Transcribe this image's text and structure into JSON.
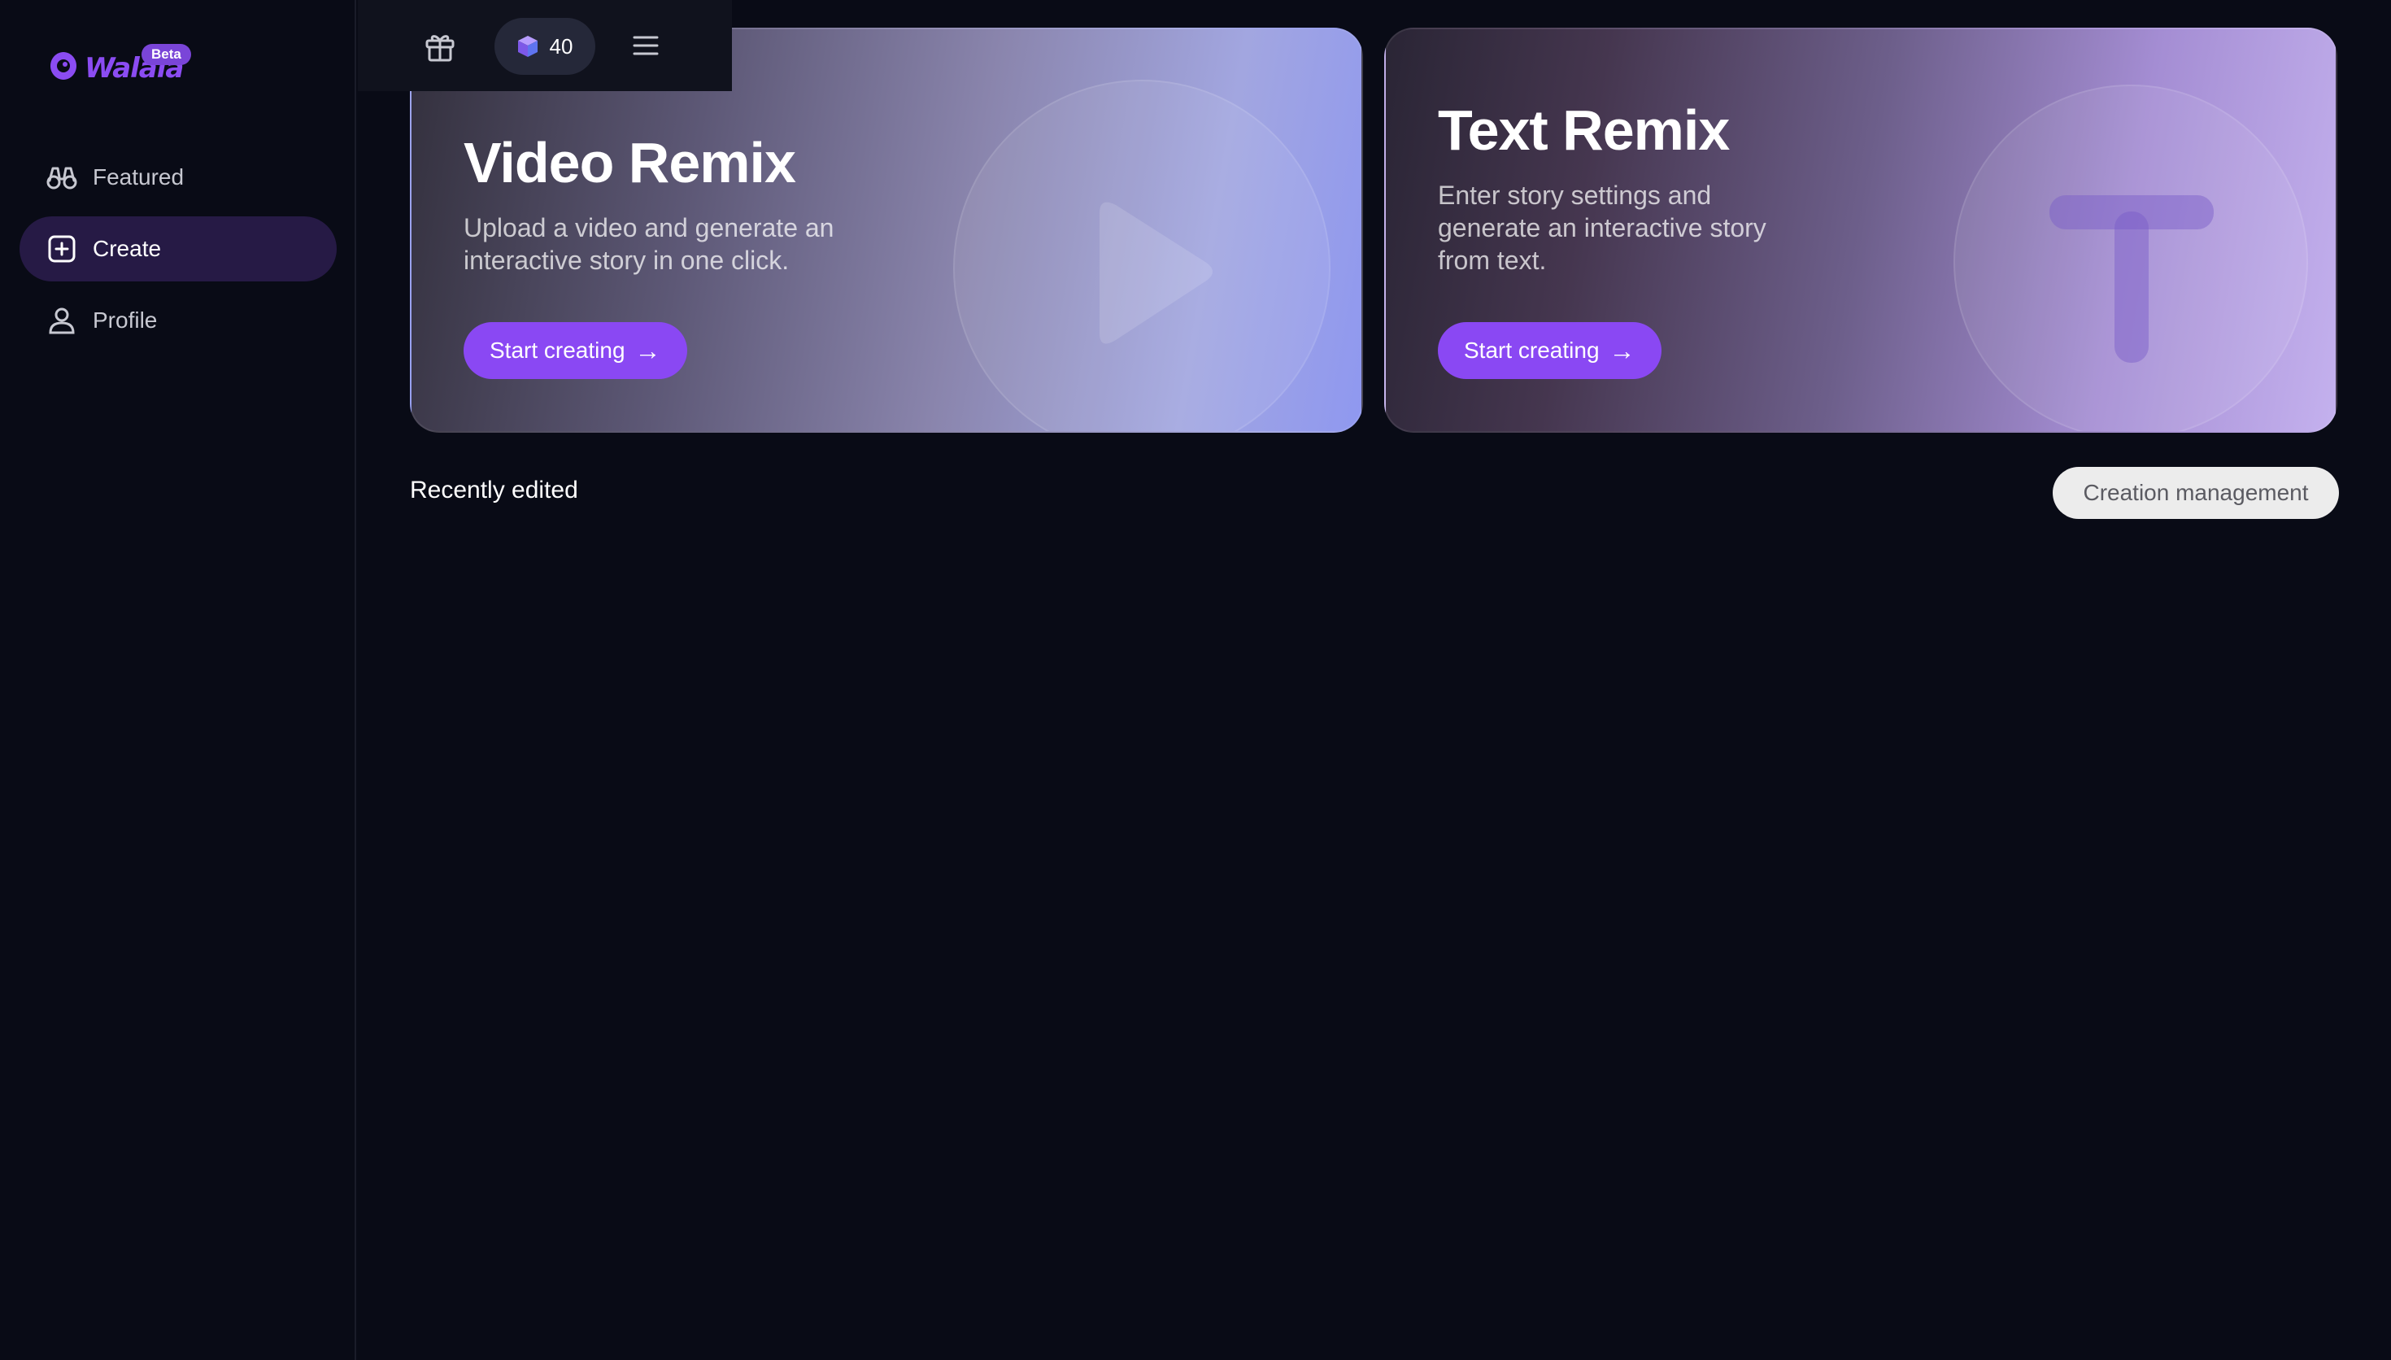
{
  "app": {
    "logo_text": "Walala",
    "beta_badge": "Beta"
  },
  "sidebar": {
    "items": [
      {
        "label": "Featured",
        "icon": "binoculars-icon",
        "active": false
      },
      {
        "label": "Create",
        "icon": "plus-square-icon",
        "active": true
      },
      {
        "label": "Profile",
        "icon": "user-icon",
        "active": false
      }
    ]
  },
  "topbar": {
    "gift_icon": "gift-icon",
    "credits_icon": "cube-gem-icon",
    "credits_value": "40",
    "menu_icon": "hamburger-menu-icon"
  },
  "cards": {
    "video": {
      "title": "Video Remix",
      "description": "Upload a video and generate an interactive story in one click.",
      "button_label": "Start creating",
      "button_arrow": "→",
      "decor_icon": "play-icon"
    },
    "text": {
      "title": "Text Remix",
      "description": "Enter story settings and generate an interactive story from text.",
      "button_label": "Start creating",
      "button_arrow": "→",
      "decor_icon": "letter-t-icon"
    }
  },
  "recent": {
    "title": "Recently edited",
    "manage_label": "Creation management"
  },
  "colors": {
    "background": "#090b16",
    "accent": "#8a48f3",
    "active_nav": "#261a45"
  }
}
